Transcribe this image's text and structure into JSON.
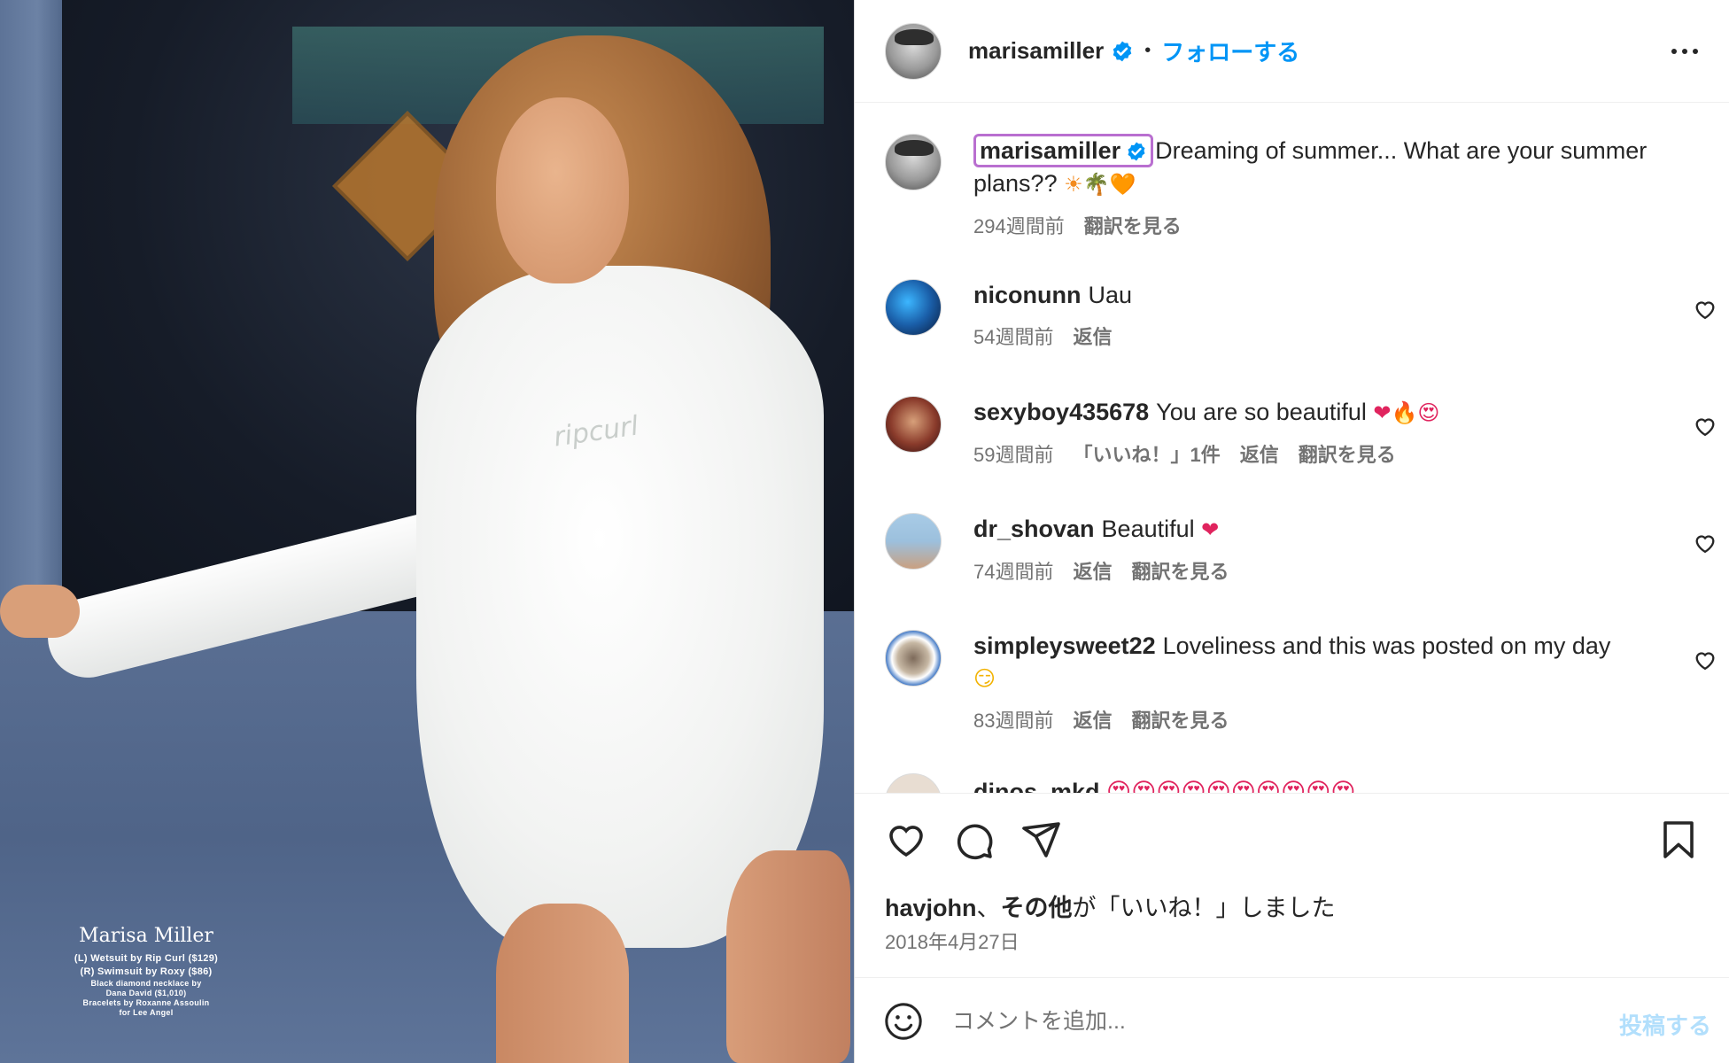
{
  "photo": {
    "shirt_logo": "ripcurl",
    "credits": {
      "name": "Marisa Miller",
      "line1": "(L) Wetsuit by Rip Curl ($129)",
      "line2": "(R) Swimsuit by Roxy ($86)",
      "line3": "Black diamond necklace by",
      "line4": "Dana David ($1,010)",
      "line5": "Bracelets by Roxanne Assoulin",
      "line6": "for Lee Angel"
    }
  },
  "header": {
    "username": "marisamiller",
    "separator": "•",
    "follow_label": "フォローする",
    "more_icon": "more-horizontal-icon"
  },
  "caption": {
    "username": "marisamiller",
    "text": "Dreaming of summer... What are your summer plans?? ",
    "emojis": "☀🌴🧡",
    "time": "294週間前",
    "translate": "翻訳を見る"
  },
  "comments": [
    {
      "username": "niconunn",
      "text": "Uau",
      "time": "54週間前",
      "reply": "返信"
    },
    {
      "username": "sexyboy435678",
      "text": "You are so beautiful ",
      "emojis": "❤🔥😍",
      "time": "59週間前",
      "likes": "「いいね！」1件",
      "reply": "返信",
      "translate": "翻訳を見る"
    },
    {
      "username": "dr_shovan",
      "text": "Beautiful ",
      "emojis": "❤",
      "time": "74週間前",
      "reply": "返信",
      "translate": "翻訳を見る"
    },
    {
      "username": "simpleysweet22",
      "text": "Loveliness and this was posted on my day",
      "emojis": "😏",
      "time": "83週間前",
      "reply": "返信",
      "translate": "翻訳を見る"
    }
  ],
  "partial_comment": {
    "username": "dinos_mkd",
    "text": "😍😍😍😍😍😍😍😍😍😍"
  },
  "actions": {
    "like_icon": "heart-icon",
    "comment_icon": "comment-icon",
    "share_icon": "share-icon",
    "save_icon": "bookmark-icon"
  },
  "likes_line": {
    "user": "havjohn",
    "sep": "、",
    "others": "その他",
    "suffix": "が「いいね！」しました"
  },
  "date": "2018年4月27日",
  "composer": {
    "placeholder": "コメントを追加...",
    "post_label": "投稿する"
  },
  "colors": {
    "link_blue": "#0095f6",
    "verified_blue": "#0095f6",
    "muted_text": "#737373",
    "post_disabled": "#b2dffc",
    "caption_highlight": "#b96fd0"
  }
}
